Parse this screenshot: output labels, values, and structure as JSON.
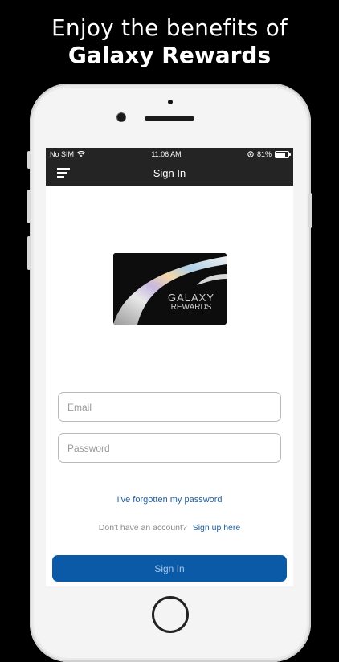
{
  "promo": {
    "line1": "Enjoy the benefits of",
    "line2": "Galaxy Rewards"
  },
  "status_bar": {
    "carrier": "No SIM",
    "wifi_icon": "wifi-icon",
    "time": "11:06 AM",
    "orientation_lock_icon": "lock-rotation-icon",
    "battery_percent": "81%",
    "battery_level": 0.81
  },
  "nav": {
    "menu_icon": "hamburger-menu-icon",
    "title": "Sign In"
  },
  "card": {
    "brand": "GALAXY",
    "brand_sub": "REWARDS"
  },
  "form": {
    "email_placeholder": "Email",
    "password_placeholder": "Password",
    "forgot_link": "I've forgotten my password",
    "no_account_text": "Don't have an account?",
    "signup_link": "Sign up here",
    "signin_button": "Sign In"
  },
  "colors": {
    "accent": "#0b5aa8",
    "link": "#1f5f9e",
    "bar": "#242424"
  }
}
